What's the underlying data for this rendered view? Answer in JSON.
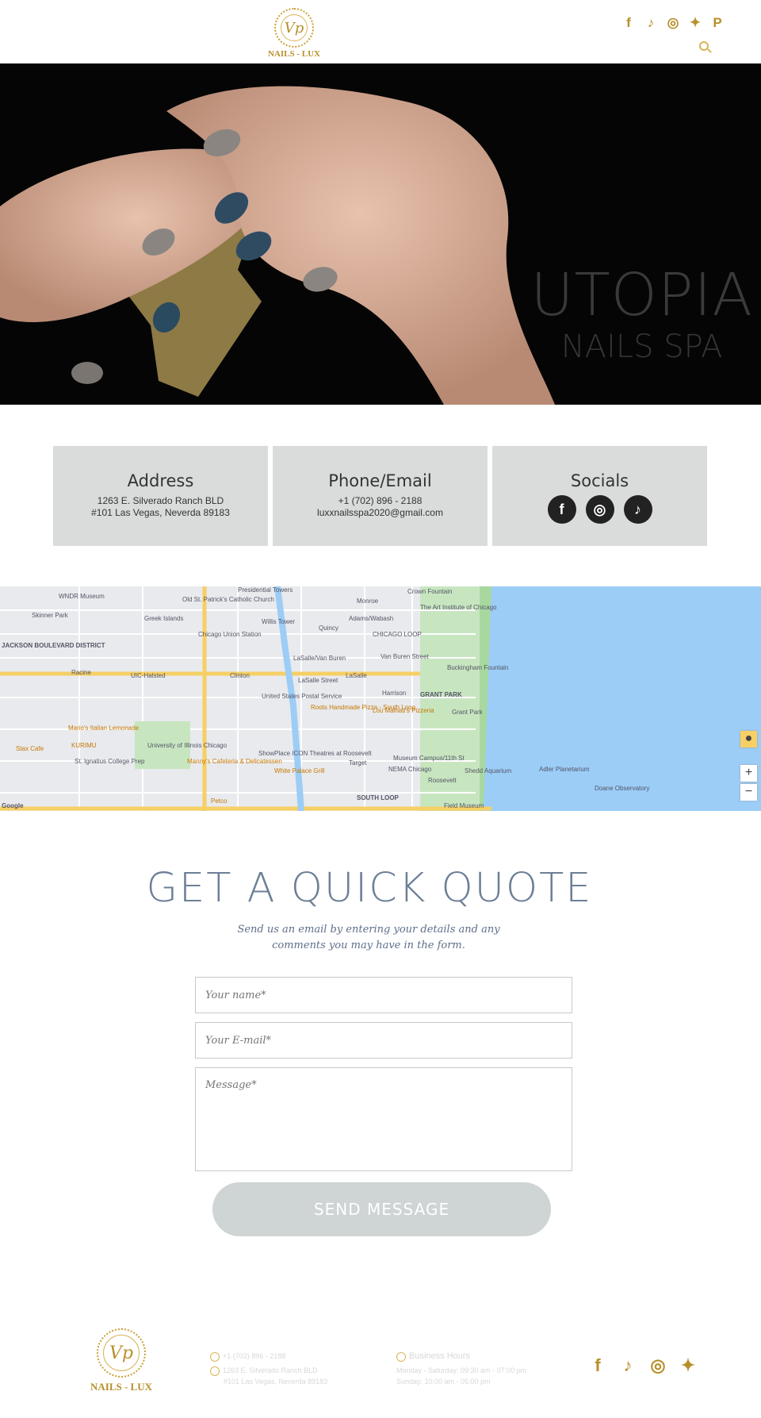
{
  "header": {
    "logo_text": "NAILS - LUX",
    "logo_monogram": "Vp",
    "social_icons": [
      "facebook-icon",
      "tiktok-icon",
      "instagram-icon",
      "twitter-icon",
      "pinterest-icon"
    ],
    "social_glyphs": [
      "f",
      "♪",
      "◎",
      "✦",
      "P"
    ]
  },
  "hero": {
    "title": "UTOPIA",
    "subtitle": "NAILS SPA"
  },
  "contact_cards": {
    "address": {
      "title": "Address",
      "line1": "1263 E. Silverado Ranch BLD",
      "line2": "#101 Las Vegas, Neverda 89183"
    },
    "phone_email": {
      "title": "Phone/Email",
      "phone": "+1 (702) 896 - 2188",
      "email": "luxxnailsspa2020@gmail.com"
    },
    "socials": {
      "title": "Socials",
      "icons": [
        "facebook-icon",
        "instagram-icon",
        "tiktok-icon"
      ],
      "glyphs": [
        "f",
        "◎",
        "♪"
      ]
    }
  },
  "map": {
    "labels": [
      "WNDR Museum",
      "Presidential Towers",
      "Old St. Patrick's Catholic Church",
      "Skinner Park",
      "Greek Islands",
      "Willis Tower",
      "Quincy",
      "Adams/Wabash",
      "Monroe",
      "Crown Fountain",
      "The Art Institute of Chicago",
      "Chicago Union Station",
      "CHICAGO LOOP",
      "LaSalle/Van Buren",
      "Van Buren Street",
      "Buckingham Fountain",
      "JACKSON BOULEVARD DISTRICT",
      "Racine",
      "UIC-Halsted",
      "Clinton",
      "LaSalle Street",
      "LaSalle",
      "United States Postal Service",
      "Harrison",
      "GRANT PARK",
      "Roosevelt",
      "Grant Park",
      "Roots Handmade Pizza - South Loop",
      "Lou Malnati's Pizzeria",
      "Mario's Italian Lemonade",
      "University of Illinois Chicago",
      "KURIMU",
      "Stax Cafe",
      "St. Ignatius College Prep",
      "Manny's Cafeteria & Delicatessen",
      "ShowPlace ICON Theatres at Roosevelt",
      "White Palace Grill",
      "Target",
      "Museum Campus/11th St",
      "NEMA Chicago",
      "Shedd Aquarium",
      "Adler Planetarium",
      "Doane Observatory",
      "Field Museum",
      "SOUTH LOOP",
      "Petco",
      "Google"
    ],
    "controls": {
      "zoom_in": "+",
      "zoom_out": "−"
    }
  },
  "quote": {
    "title": "GET A QUICK QUOTE",
    "subtitle": "Send us an email by entering your details and any comments you may have in the form.",
    "name_placeholder": "Your name*",
    "email_placeholder": "Your E-mail*",
    "message_placeholder": "Message*",
    "send_label": "SEND MESSAGE"
  },
  "footer": {
    "logo_text": "NAILS - LUX",
    "logo_monogram": "Vp",
    "phone": "+1 (702) 896 - 2188",
    "address_line1": "1263 E. Silverado Ranch BLD",
    "address_line2": "#101 Las Vegas, Neverda 89183",
    "hours_title": "Business Hours",
    "hours_line1": "Monday - Saturday: 09:30 am - 07:00 pm",
    "hours_line2": "Sunday: 10:00 am - 05:00 pm",
    "social_icons": [
      "facebook-icon",
      "tiktok-icon",
      "instagram-icon",
      "twitter-icon"
    ],
    "social_glyphs": [
      "f",
      "♪",
      "◎",
      "✦"
    ]
  },
  "colors": {
    "gold": "#b8902b",
    "card_bg": "#d9dcda",
    "quote_title": "#6c7f96",
    "button_bg": "#cfd4d4"
  }
}
